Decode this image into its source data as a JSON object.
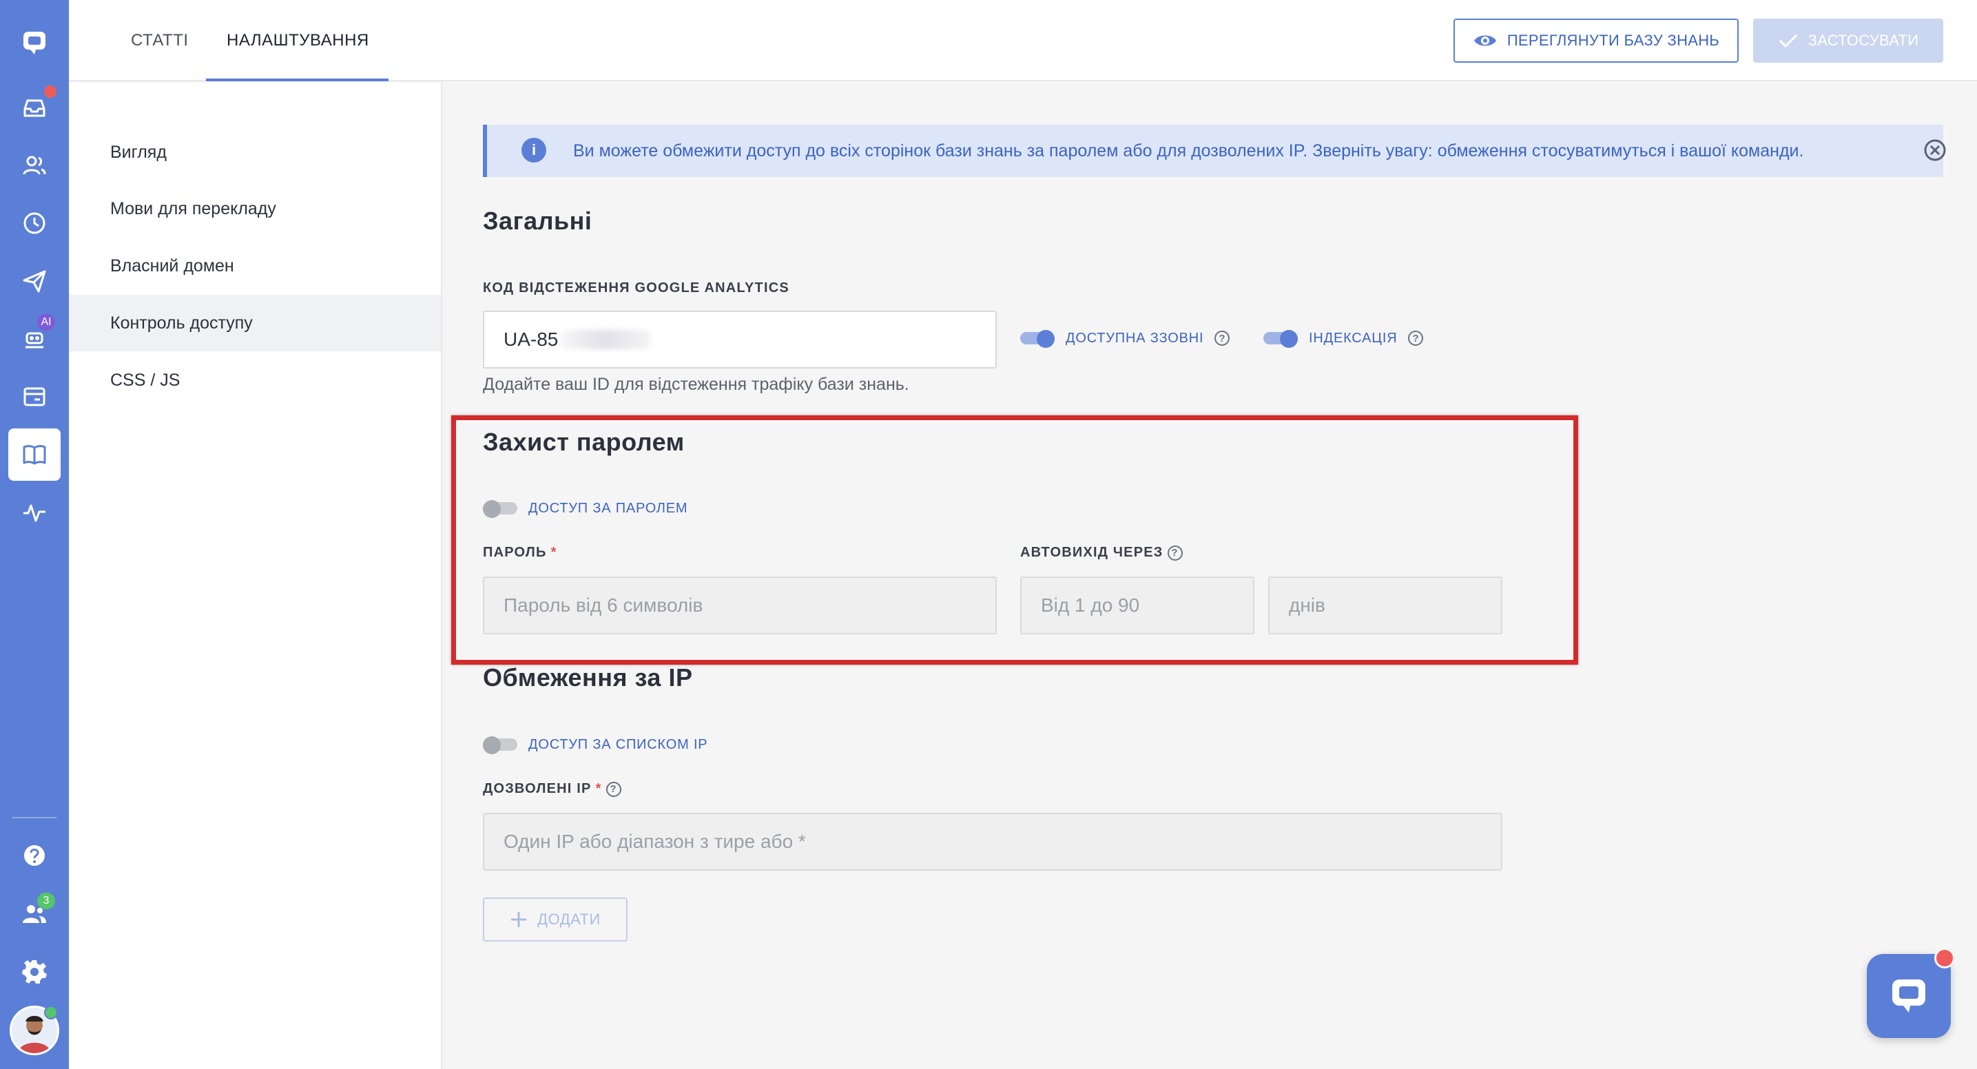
{
  "tabs": [
    {
      "label": "СТАТТІ"
    },
    {
      "label": "НАЛАШТУВАННЯ"
    }
  ],
  "header": {
    "view_button": "ПЕРЕГЛЯНУТИ БАЗУ ЗНАНЬ",
    "apply_button": "ЗАСТОСУВАТИ"
  },
  "rail": {
    "ai_badge": "AI",
    "team_badge": "3",
    "icons": [
      "chat-logo-icon",
      "inbox-icon",
      "contacts-icon",
      "clock-icon",
      "send-icon",
      "bot-icon",
      "widget-icon",
      "knowledge-base-icon",
      "analytics-icon",
      "help-icon",
      "team-icon",
      "settings-icon"
    ]
  },
  "subnav": {
    "items": [
      {
        "label": "Вигляд"
      },
      {
        "label": "Мови для перекладу"
      },
      {
        "label": "Власний домен"
      },
      {
        "label": "Контроль доступу"
      },
      {
        "label": "CSS / JS"
      }
    ]
  },
  "info": {
    "text": "Ви можете обмежити доступ до всіх сторінок бази знань за паролем або для дозволених IP. Зверніть увагу: обмеження стосуватимуться і вашої команди."
  },
  "general": {
    "title": "Загальні",
    "ga_label": "КОД ВІДСТЕЖЕННЯ GOOGLE ANALYTICS",
    "ga_value": "UA-85",
    "ga_hint": "Додайте ваш ID для відстеження трафіку бази знань.",
    "public_toggle": "ДОСТУПНА ЗЗОВНІ",
    "indexing_toggle": "ІНДЕКСАЦІЯ"
  },
  "password": {
    "title": "Захист паролем",
    "toggle_label": "ДОСТУП ЗА ПАРОЛЕМ",
    "password_label": "ПАРОЛЬ",
    "required_mark": "*",
    "password_placeholder": "Пароль від 6 символів",
    "logout_label": "АВТОВИХІД ЧЕРЕЗ",
    "logout_placeholder": "Від 1 до 90",
    "days_placeholder": "днів"
  },
  "ip": {
    "title": "Обмеження за IP",
    "toggle_label": "ДОСТУП ЗА СПИСКОМ IP",
    "allowed_label": "ДОЗВОЛЕНІ IP",
    "required_mark": "*",
    "ip_placeholder": "Один IP або діапазон з тире або *",
    "add_button": "ДОДАТИ"
  },
  "colors": {
    "accent": "#5b7fd6",
    "highlight": "#d32b2b",
    "info_bg": "#dde6f8"
  }
}
